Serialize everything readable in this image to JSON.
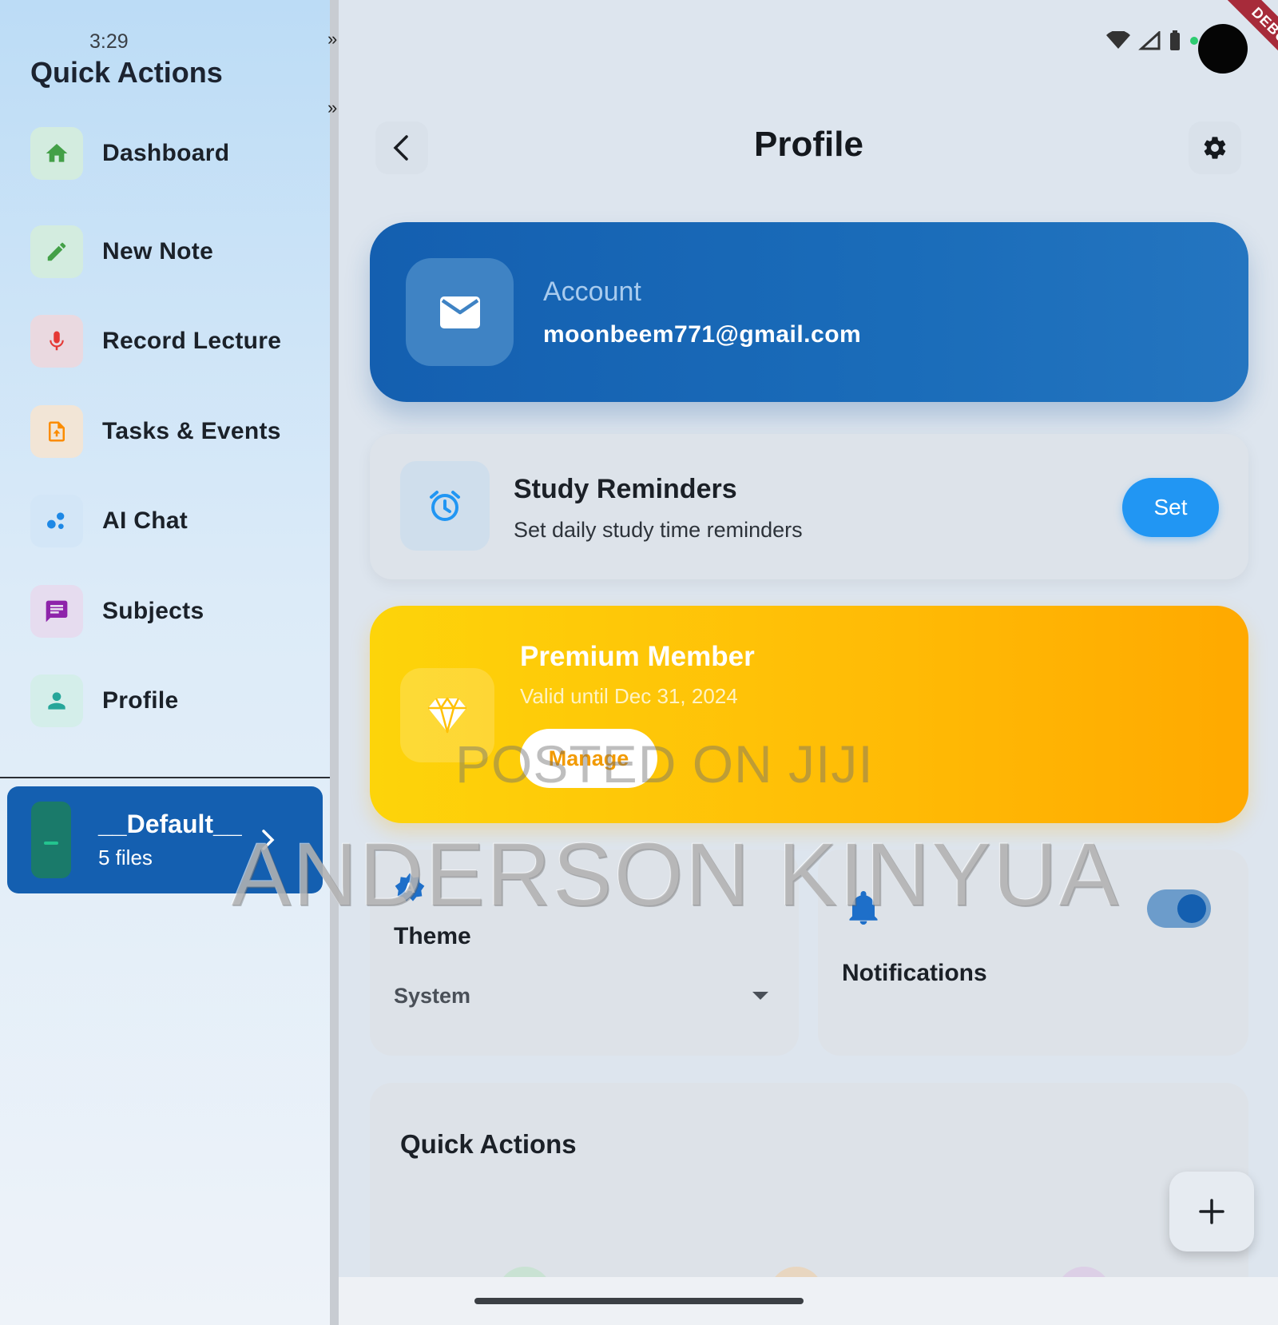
{
  "status_bar": {
    "time": "3:29",
    "debug_label": "DEBUG"
  },
  "drawer": {
    "title": "Quick Actions",
    "items": [
      {
        "label": "Dashboard",
        "icon": "home-icon",
        "color": "#43a047",
        "bg": "#d3ecdf"
      },
      {
        "label": "New Note",
        "icon": "pencil-icon",
        "color": "#43a047",
        "bg": "#d3ecdf"
      },
      {
        "label": "Record Lecture",
        "icon": "microphone-icon",
        "color": "#e53935",
        "bg": "#ead9e0"
      },
      {
        "label": "Tasks & Events",
        "icon": "task-file-icon",
        "color": "#fb8c00",
        "bg": "#f2e5d6"
      },
      {
        "label": "AI Chat",
        "icon": "chat-bubbles-icon",
        "color": "#1e88e5",
        "bg": "#d3e6f7"
      },
      {
        "label": "Subjects",
        "icon": "subject-message-icon",
        "color": "#8e24aa",
        "bg": "#e6dcef"
      },
      {
        "label": "Profile",
        "icon": "person-icon",
        "color": "#26a69a",
        "bg": "#d4eeea"
      }
    ],
    "folder": {
      "name": "__Default__",
      "count": "5 files"
    }
  },
  "header": {
    "title": "Profile"
  },
  "account": {
    "label": "Account",
    "email": "moonbeem771@gmail.com"
  },
  "reminders": {
    "title": "Study Reminders",
    "subtitle": "Set daily study time reminders",
    "button_label": "Set"
  },
  "premium": {
    "title": "Premium Member",
    "subtitle": "Valid until Dec 31, 2024",
    "button_label": "Manage"
  },
  "theme": {
    "title": "Theme",
    "value": "System"
  },
  "notifications": {
    "title": "Notifications",
    "enabled": true
  },
  "quick_actions": {
    "title": "Quick Actions"
  },
  "watermark": {
    "line1": "POSTED ON JIJI",
    "line2": "ANDERSON KINYUA"
  },
  "colors": {
    "primary": "#145fb0",
    "accent_blue": "#2196f3",
    "premium_start": "#fdd40a",
    "premium_end": "#ffa900"
  }
}
